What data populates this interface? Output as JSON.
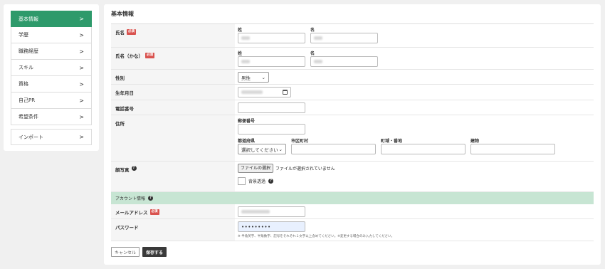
{
  "sidebar": {
    "items": [
      {
        "label": "基本情報",
        "active": true
      },
      {
        "label": "学歴"
      },
      {
        "label": "職務経歴"
      },
      {
        "label": "スキル"
      },
      {
        "label": "資格"
      },
      {
        "label": "自己PR"
      },
      {
        "label": "希望条件"
      }
    ],
    "import_label": "インポート",
    "chevron": ">"
  },
  "main": {
    "title": "基本情報",
    "required_badge": "必須",
    "name": {
      "label": "氏名",
      "sei": "姓",
      "mei": "名"
    },
    "kana": {
      "label": "氏名（かな）",
      "sei": "姓",
      "mei": "名"
    },
    "gender": {
      "label": "性別",
      "value": "男性"
    },
    "birthday": {
      "label": "生年月日"
    },
    "phone": {
      "label": "電話番号"
    },
    "address": {
      "label": "住所",
      "postal": "郵便番号",
      "prefecture": "都道府県",
      "prefecture_value": "選択してください",
      "city": "市区町村",
      "street": "町域・番地",
      "building": "建物"
    },
    "photo": {
      "label": "顔写真",
      "file_button": "ファイルの選択",
      "file_status": "ファイルが選択されていません",
      "transparent_label": "背景透過"
    },
    "account": {
      "bar_label": "アカウント情報",
      "email_label": "メールアドレス",
      "password_label": "パスワード",
      "password_value": "•••••••••",
      "password_hint": "※ 半角英字、半角数字、記号をそれぞれ１文字以上含めてください。※変更する場合のみ入力してください。"
    },
    "cancel_label": "キャンセル",
    "save_label": "保存する"
  }
}
